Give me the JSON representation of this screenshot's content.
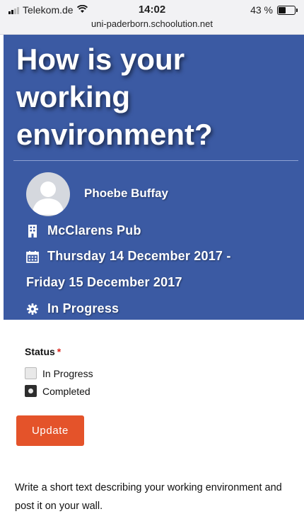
{
  "statusbar": {
    "carrier": "Telekom.de",
    "time": "14:02",
    "battery_text": "43 %",
    "battery_level": 0.43,
    "url": "uni-paderborn.schoolution.net"
  },
  "hero": {
    "title": "How is your working environment?",
    "author": "Phoebe Buffay",
    "location": "McClarens Pub",
    "date_line1": "Thursday 14 December 2017 -",
    "date_line2": "Friday 15 December 2017",
    "status": "In Progress",
    "background_color": "#3b5aa3"
  },
  "form": {
    "status_label": "Status",
    "required_marker": "*",
    "options": [
      {
        "label": "In Progress",
        "selected": false
      },
      {
        "label": "Completed",
        "selected": true
      }
    ],
    "update_button": "Update",
    "accent_color": "#e4532a"
  },
  "description": "Write a short text describing your working environment and post it on your wall."
}
